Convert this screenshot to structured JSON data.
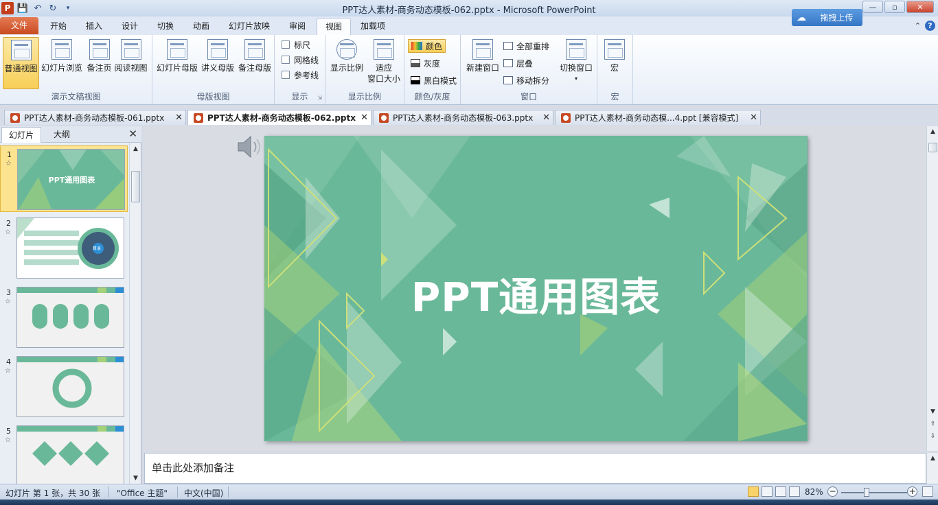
{
  "window": {
    "title": "PPT达人素材-商务动态模板-062.pptx - Microsoft PowerPoint",
    "app_icon": "P",
    "min": "—",
    "max": "▫",
    "close": "✕"
  },
  "qat": {
    "save_icon": "save-icon",
    "undo_icon": "undo-icon",
    "redo_icon": "redo-icon"
  },
  "upload_button": {
    "label": "拖拽上传"
  },
  "ribbon_tabs": [
    {
      "label": "文件"
    },
    {
      "label": "开始"
    },
    {
      "label": "插入"
    },
    {
      "label": "设计"
    },
    {
      "label": "切换"
    },
    {
      "label": "动画"
    },
    {
      "label": "幻灯片放映"
    },
    {
      "label": "审阅"
    },
    {
      "label": "视图",
      "active": true
    },
    {
      "label": "加载项"
    }
  ],
  "ribbon": {
    "presentation_views": {
      "label": "演示文稿视图",
      "buttons": [
        {
          "label": "普通视图",
          "selected": true
        },
        {
          "label": "幻灯片浏览"
        },
        {
          "label": "备注页"
        },
        {
          "label": "阅读视图"
        }
      ]
    },
    "master_views": {
      "label": "母版视图",
      "buttons": [
        {
          "label": "幻灯片母版"
        },
        {
          "label": "讲义母版"
        },
        {
          "label": "备注母版"
        }
      ]
    },
    "show": {
      "label": "显示",
      "checks": [
        {
          "label": "标尺"
        },
        {
          "label": "网格线"
        },
        {
          "label": "参考线"
        }
      ]
    },
    "zoom": {
      "label": "显示比例",
      "buttons": [
        {
          "label": "显示比例"
        },
        {
          "label": "适应",
          "label2": "窗口大小"
        }
      ]
    },
    "color": {
      "label": "颜色/灰度",
      "items": [
        {
          "label": "颜色",
          "selected": true
        },
        {
          "label": "灰度"
        },
        {
          "label": "黑白模式"
        }
      ]
    },
    "window": {
      "label": "窗口",
      "new_window": "新建窗口",
      "items": [
        {
          "label": "全部重排"
        },
        {
          "label": "层叠"
        },
        {
          "label": "移动拆分"
        }
      ],
      "switch": "切换窗口"
    },
    "macro": {
      "label": "宏",
      "button": "宏"
    }
  },
  "doc_tabs": [
    {
      "label": "PPT达人素材-商务动态模板-061.pptx"
    },
    {
      "label": "PPT达人素材-商务动态模板-062.pptx",
      "active": true
    },
    {
      "label": "PPT达人素材-商务动态模板-063.pptx"
    },
    {
      "label": "PPT达人素材-商务动态模...4.ppt [兼容模式]"
    }
  ],
  "panel": {
    "tabs": [
      {
        "label": "幻灯片",
        "active": true
      },
      {
        "label": "大纲"
      }
    ],
    "slides": [
      {
        "number": "1",
        "selected": true,
        "title": "PPT通用图表"
      },
      {
        "number": "2",
        "title": "目录"
      },
      {
        "number": "3",
        "title": ""
      },
      {
        "number": "4",
        "title": ""
      },
      {
        "number": "5",
        "title": ""
      }
    ]
  },
  "slide": {
    "title": "PPT通用图表",
    "background": "#6ab89a"
  },
  "notes": {
    "placeholder": "单击此处添加备注"
  },
  "status": {
    "slide_info": "幻灯片 第 1 张，共 30 张",
    "theme": "\"Office 主题\"",
    "language": "中文(中国)",
    "zoom": "82%"
  }
}
